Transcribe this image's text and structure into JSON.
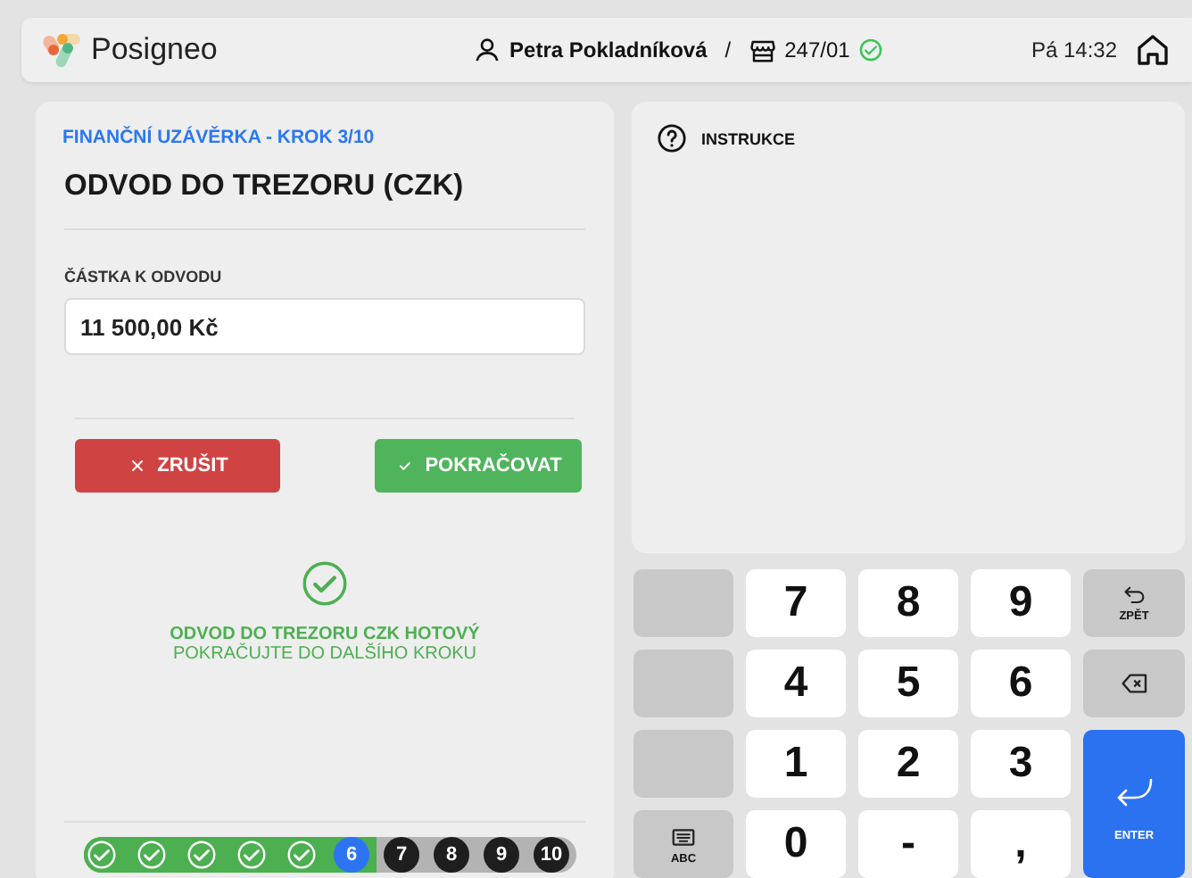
{
  "header": {
    "brand": "Posigneo",
    "user": "Petra Pokladníková",
    "separator": "/",
    "register": "247/01",
    "register_online": true,
    "clock": "Pá 14:32"
  },
  "wizard": {
    "step_caption": "FINANČNÍ UZÁVĚRKA - KROK 3/10",
    "title": "ODVOD DO TREZORU (CZK)",
    "amount_label": "ČÁSTKA K ODVODU",
    "amount_value": "11 500,00 Kč",
    "buttons": [
      {
        "kind": "cancel",
        "label": "ZRUŠIT"
      },
      {
        "kind": "confirm",
        "label": "POKRAČOVAT"
      }
    ],
    "status_title": "ODVOD DO TREZORU CZK HOTOVÝ",
    "status_hint": "POKRAČUJTE DO DALŠÍHO KROKU",
    "steps": [
      {
        "completed": true,
        "current": false
      },
      {
        "completed": true,
        "current": false
      },
      {
        "completed": true,
        "current": false
      },
      {
        "completed": true,
        "current": false
      },
      {
        "completed": true,
        "current": false
      },
      {
        "label": "6",
        "completed": false,
        "current": true
      },
      {
        "label": "7",
        "completed": false,
        "current": false
      },
      {
        "label": "8",
        "completed": false,
        "current": false
      },
      {
        "label": "9",
        "completed": false,
        "current": false
      },
      {
        "label": "10",
        "completed": false,
        "current": false
      }
    ]
  },
  "instructions": {
    "title": "INSTRUKCE"
  },
  "keypad": [
    {
      "kind": "blank"
    },
    {
      "kind": "digit",
      "label": "7"
    },
    {
      "kind": "digit",
      "label": "8"
    },
    {
      "kind": "digit",
      "label": "9"
    },
    {
      "kind": "back",
      "label": "ZPĚT"
    },
    {
      "kind": "blank"
    },
    {
      "kind": "digit",
      "label": "4"
    },
    {
      "kind": "digit",
      "label": "5"
    },
    {
      "kind": "digit",
      "label": "6"
    },
    {
      "kind": "backspace"
    },
    {
      "kind": "blank"
    },
    {
      "kind": "digit",
      "label": "1"
    },
    {
      "kind": "digit",
      "label": "2"
    },
    {
      "kind": "digit",
      "label": "3"
    },
    {
      "kind": "enter",
      "label": "ENTER"
    },
    {
      "kind": "keyboard",
      "label": "ABC"
    },
    {
      "kind": "digit",
      "label": "0"
    },
    {
      "kind": "digit",
      "label": "-"
    },
    {
      "kind": "digit",
      "label": ","
    }
  ]
}
